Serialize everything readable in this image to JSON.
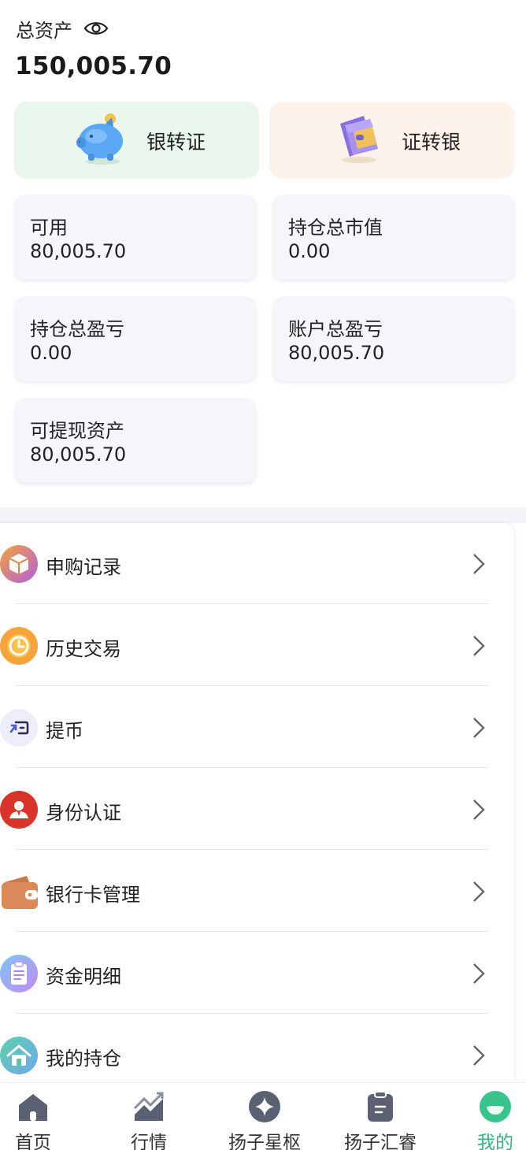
{
  "summary": {
    "total_assets_label": "总资产",
    "total_assets_value": "150,005.70"
  },
  "transfers": {
    "bank_to_securities": "银转证",
    "securities_to_bank": "证转银"
  },
  "stats": [
    {
      "label": "可用",
      "value": "80,005.70"
    },
    {
      "label": "持仓总市值",
      "value": "0.00"
    },
    {
      "label": "持仓总盈亏",
      "value": "0.00"
    },
    {
      "label": "账户总盈亏",
      "value": "80,005.70"
    },
    {
      "label": "可提现资产",
      "value": "80,005.70"
    }
  ],
  "menu": [
    {
      "label": "申购记录",
      "icon": "cube-icon"
    },
    {
      "label": "历史交易",
      "icon": "clock-icon"
    },
    {
      "label": "提币",
      "icon": "withdraw-icon"
    },
    {
      "label": "身份认证",
      "icon": "user-badge-icon"
    },
    {
      "label": "银行卡管理",
      "icon": "wallet-icon"
    },
    {
      "label": "资金明细",
      "icon": "clipboard-icon"
    },
    {
      "label": "我的持仓",
      "icon": "house-icon"
    }
  ],
  "nav": [
    {
      "label": "首页",
      "icon": "home-icon"
    },
    {
      "label": "行情",
      "icon": "chart-icon"
    },
    {
      "label": "扬子星枢",
      "icon": "star-icon"
    },
    {
      "label": "扬子汇睿",
      "icon": "clipboard-icon"
    },
    {
      "label": "我的",
      "icon": "profile-icon",
      "active": true
    }
  ],
  "colors": {
    "accent": "#2fb584",
    "transfer_in_bg": "#e9f7ec",
    "transfer_out_bg": "#fdf3ea",
    "card_bg": "#f5f6fa"
  }
}
